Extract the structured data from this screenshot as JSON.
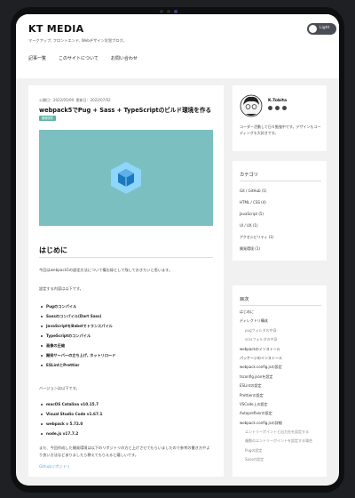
{
  "header": {
    "logo": "KT MEDIA",
    "tagline": "マークアップ, フロントエンド, Webデザイン学習ブログ。",
    "theme_toggle_label": "Light"
  },
  "nav": {
    "items": [
      "記事一覧",
      "このサイトについて",
      "お問い合わせ"
    ]
  },
  "post": {
    "published": "公開日：2022/05/09",
    "updated": "更新日：2022/07/02",
    "title": "webpack5でPug + Sass + TypeScriptのビルド環境を作る",
    "tag": "開発環境",
    "section_heading": "はじめに",
    "intro": "今回はwebpack5の設定方法について備忘録として残しておきたいと思います。",
    "settings_intro": "設定する内容は以下です。",
    "features": [
      "Pugのコンパイル",
      "Sassのコンパイル(Dart Sass)",
      "JavaScriptをBabelでトランスパイル",
      "TypeScriptのコンパイル",
      "画像の圧縮",
      "開発サーバーの立ち上げ, ホットリロード",
      "ESLintとPrettier"
    ],
    "versions_intro": "バージョンは以下です。",
    "versions": [
      "macOS Catalina v10.15.7",
      "Visual Studio Code v1.67.1",
      "webpack v 5.72.0",
      "node.js v17.7.2"
    ],
    "repo_note": "また、今回作成した開発環境は以下のリポジトリの方と上げさせてもらいましたので参考の書き方やより良い方法などありましたら教えてもらえると嬉しいです。",
    "repo_link": "Githubリポジトリ"
  },
  "profile": {
    "name": "K.Tobita",
    "bio": "コーダー活動して日々勉強中です。デザインもコーディングも大好きです。"
  },
  "categories": {
    "title": "カテゴリ",
    "items": [
      "Git / GitHub (1)",
      "HTML / CSS (4)",
      "JavaScript (5)",
      "UI / UX (1)",
      "アクセシビリティ (1)",
      "開発環境 (1)"
    ]
  },
  "toc": {
    "title": "目次",
    "items": [
      {
        "label": "はじめに",
        "sub": false
      },
      {
        "label": "ディレクトリ構成",
        "sub": false
      },
      {
        "label": "pugフォルダの中身",
        "sub": true
      },
      {
        "label": "scssフォルダの中身",
        "sub": true
      },
      {
        "label": "webpackのインストール",
        "sub": false
      },
      {
        "label": "パッケージのインストール",
        "sub": false
      },
      {
        "label": "webpack.config.jsの設定",
        "sub": false
      },
      {
        "label": "tsconfig.jsonを設定",
        "sub": false
      },
      {
        "label": "ESLintの設定",
        "sub": false
      },
      {
        "label": "Prettierの設定",
        "sub": false
      },
      {
        "label": "VSCode上の設定",
        "sub": false
      },
      {
        "label": "Autoprefixerの設定",
        "sub": false
      },
      {
        "label": "webpack.config.jsの詳細",
        "sub": false
      },
      {
        "label": "エントリーポイントと出力先を設定する",
        "sub": true
      },
      {
        "label": "複数のエントリーポイントを設定する場合",
        "sub": true
      },
      {
        "label": "Pugの設定",
        "sub": true
      },
      {
        "label": "Sassの設定",
        "sub": true
      }
    ]
  },
  "colors": {
    "accent": "#5fb5a8",
    "hero_bg": "#7bbfc0",
    "link": "#5ea8d8"
  },
  "icons": {
    "theme_toggle": "toggle-knob-icon",
    "hero": "webpack-cube-icon",
    "avatar": "avatar-illustration",
    "socials": [
      "twitter-icon",
      "github-icon",
      "mail-icon"
    ]
  }
}
